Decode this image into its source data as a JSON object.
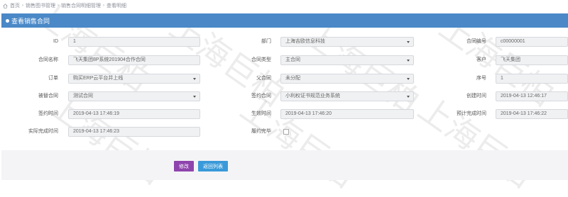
{
  "breadcrumb": {
    "items": [
      "首页",
      "销售图书管理",
      "销售合同明细管理",
      "查看明细"
    ]
  },
  "panel": {
    "title": "查看销售合同"
  },
  "form": {
    "rows": [
      [
        {
          "label": "ID",
          "value": "1",
          "kind": "text"
        },
        {
          "label": "部门",
          "value": "上海吉欧信息科技",
          "kind": "select"
        },
        {
          "label": "合同编号",
          "value": "c00000001",
          "kind": "text"
        }
      ],
      [
        {
          "label": "合同名称",
          "value": "飞天集团8P系统201904合作合同",
          "kind": "text"
        },
        {
          "label": "合同类型",
          "value": "主合同",
          "kind": "select"
        },
        {
          "label": "客户",
          "value": "飞天集团",
          "kind": "text"
        }
      ],
      [
        {
          "label": "订单",
          "value": "购买ERP云平台并上线",
          "kind": "select"
        },
        {
          "label": "父合同",
          "value": "未分配",
          "kind": "select"
        },
        {
          "label": "序号",
          "value": "1",
          "kind": "text"
        }
      ],
      [
        {
          "label": "被替合同",
          "value": "测试合同",
          "kind": "select"
        },
        {
          "label": "签约合同",
          "value": "小利权证书规范业务系统",
          "kind": "select"
        },
        {
          "label": "创建时间",
          "value": "2019-04-13 12:46:17",
          "kind": "text"
        }
      ],
      [
        {
          "label": "签约时间",
          "value": "2019-04-13 17:46:19",
          "kind": "text"
        },
        {
          "label": "生效时间",
          "value": "2019-04-13 17:46:20",
          "kind": "text"
        },
        {
          "label": "预计完成时间",
          "value": "2019-04-13 17:46:22",
          "kind": "text"
        }
      ],
      [
        {
          "label": "实际完成时间",
          "value": "2019-04-13 17:46:23",
          "kind": "text"
        },
        {
          "label": "履约完毕",
          "value": "",
          "kind": "checkbox"
        }
      ]
    ]
  },
  "buttons": {
    "edit": "修改",
    "back": "返回列表"
  },
  "watermark": "上海巨柏"
}
